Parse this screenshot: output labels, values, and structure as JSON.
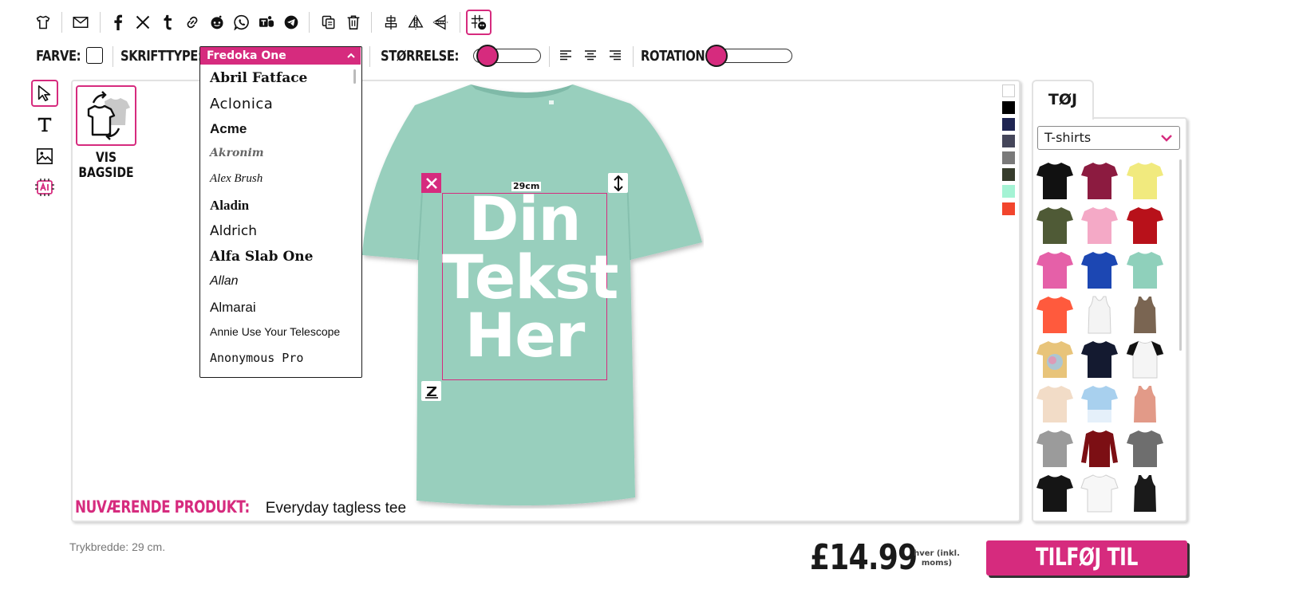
{
  "toolbar": {
    "icons": [
      "tshirt-icon",
      "mail-icon",
      "facebook-icon",
      "x-icon",
      "tumblr-icon",
      "link-icon",
      "reddit-icon",
      "whatsapp-icon",
      "teams-icon",
      "telegram-icon",
      "copy-icon",
      "trash-icon",
      "align-vertical-icon",
      "flip-horizontal-icon",
      "flip-vertical-icon",
      "grid-icon"
    ]
  },
  "text_controls": {
    "color_label": "FARVE:",
    "font_label": "SKRIFTTYPE:",
    "size_label": "STØRRELSE:",
    "rotation_label": "ROTATION:",
    "size_value": 0.08,
    "rotation_value": 0.0
  },
  "font_dropdown": {
    "selected": "Fredoka One",
    "options": [
      "Abril Fatface",
      "Aclonica",
      "Acme",
      "Akronim",
      "Alex Brush",
      "Aladin",
      "Aldrich",
      "Alfa Slab One",
      "Allan",
      "Almarai",
      "Annie Use Your Telescope",
      "Anonymous Pro"
    ]
  },
  "side_tools": [
    "pointer-icon",
    "text-tool-icon",
    "image-tool-icon",
    "ai-tool-icon"
  ],
  "back_toggle": {
    "label_line1": "VIS",
    "label_line2": "BAGSIDE"
  },
  "design": {
    "text_lines": [
      "Din",
      "Tekst",
      "Her"
    ],
    "width_label": "29cm",
    "shirt_color": "#98cfbd",
    "text_color": "#ffffff"
  },
  "swatches": [
    "#ffffff",
    "#000000",
    "#1f2552",
    "#45465a",
    "#7a7a7a",
    "#363c2c",
    "#a4f3d4",
    "#f2452d"
  ],
  "current_product": {
    "label": "NUVÆRENDE PRODUKT:",
    "name": "Everyday tagless tee"
  },
  "panel": {
    "tab": "TØJ",
    "category": "T-shirts",
    "products": [
      {
        "name": "black tee",
        "color": "#111111"
      },
      {
        "name": "burgundy tee",
        "color": "#8c1b40"
      },
      {
        "name": "yellow tee",
        "color": "#f1ea7e"
      },
      {
        "name": "olive tee",
        "color": "#4f5a36"
      },
      {
        "name": "pink tee",
        "color": "#f4a9c6"
      },
      {
        "name": "red tee",
        "color": "#b8111a"
      },
      {
        "name": "fuchsia tee",
        "color": "#e560a8"
      },
      {
        "name": "royal blue tee",
        "color": "#1c47b3"
      },
      {
        "name": "mint tee",
        "color": "#8fd0bb"
      },
      {
        "name": "coral tee",
        "color": "#ff5a3d"
      },
      {
        "name": "white tank",
        "color": "#f4f4f4"
      },
      {
        "name": "brown tank",
        "color": "#7a6552"
      },
      {
        "name": "tie-dye tee",
        "color": "#e8c47a"
      },
      {
        "name": "navy tee",
        "color": "#141a30"
      },
      {
        "name": "raglan tee",
        "color": "#f5f5f5"
      },
      {
        "name": "cream tee",
        "color": "#f2dcc7"
      },
      {
        "name": "sky fade tee",
        "color": "#a8d0ee"
      },
      {
        "name": "salmon tank",
        "color": "#e29a88"
      },
      {
        "name": "grey crop tee",
        "color": "#9b9b9b"
      },
      {
        "name": "maroon longsleeve",
        "color": "#7c0f14"
      },
      {
        "name": "charcoal tee",
        "color": "#6e6e6e"
      },
      {
        "name": "black fitted tee",
        "color": "#151515"
      },
      {
        "name": "white fitted tee",
        "color": "#f7f7f7"
      },
      {
        "name": "black strappy tank",
        "color": "#1a1a1a"
      }
    ]
  },
  "footer": {
    "print_width": "Trykbredde: 29 cm.",
    "price": "£14.99",
    "price_note": "hver (inkl. moms)",
    "cart_button": "TILFØJ TIL KURV"
  },
  "colors": {
    "accent": "#d62b7e"
  }
}
